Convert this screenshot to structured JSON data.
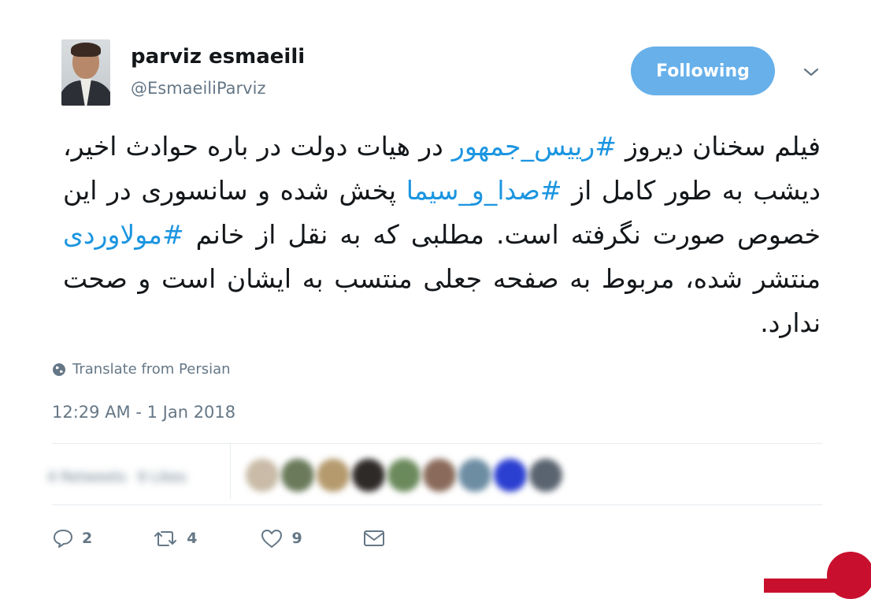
{
  "profile": {
    "name": "parviz esmaeili",
    "handle": "@EsmaeiliParviz"
  },
  "follow_button": {
    "label": "Following"
  },
  "tweet": {
    "segments": [
      {
        "text": "فیلم سخنان دیروز ",
        "hashtag": false
      },
      {
        "text": "#رییس_جمهور",
        "hashtag": true
      },
      {
        "text": " در هیات دولت در باره حوادث اخیر، دیشب به طور کامل از ",
        "hashtag": false
      },
      {
        "text": "#صدا_و_سیما",
        "hashtag": true
      },
      {
        "text": " پخش شده و سانسوری در این خصوص صورت نگرفته است. مطلبی که به نقل از خانم ",
        "hashtag": false
      },
      {
        "text": "#مولاوردی",
        "hashtag": true
      },
      {
        "text": " منتشر شده، مربوط به صفحه جعلی منتسب به ایشان است و صحت ندارد.",
        "hashtag": false
      }
    ],
    "translate_label": "Translate from Persian",
    "timestamp": "12:29 AM - 1 Jan 2018"
  },
  "stats": {
    "retweets_label": "4 Retweets",
    "likes_label": "9 Likes",
    "liker_avatar_colors": [
      "#c9bba7",
      "#6a7a5a",
      "#b59a6e",
      "#2e2a28",
      "#6b8a5c",
      "#8a6a5a",
      "#6d8da3",
      "#2b3fd1",
      "#5a6470"
    ]
  },
  "actions": {
    "reply_count": "2",
    "retweet_count": "4",
    "like_count": "9"
  },
  "colors": {
    "accent": "#1b95e0",
    "button_bg": "#67b0ea",
    "muted": "#657786"
  }
}
